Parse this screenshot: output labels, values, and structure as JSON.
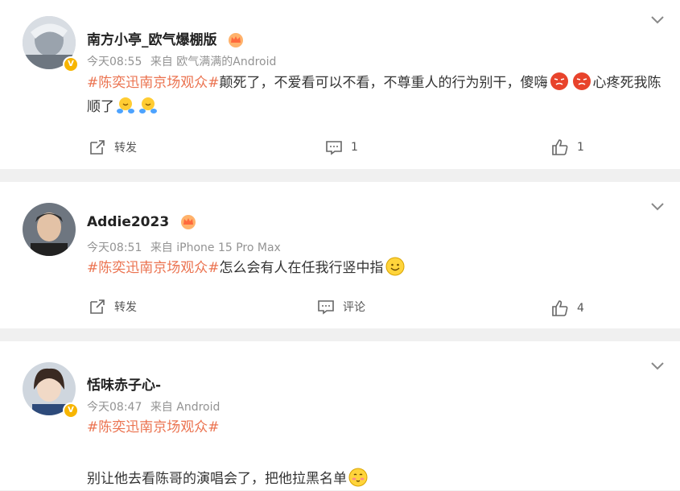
{
  "posts": [
    {
      "username": "南方小亭_欧气爆棚版",
      "time": "今天08:55",
      "source": "来自 欧气满满的Android",
      "hashtag": "#陈奕迅南京场观众#",
      "text_a": "颠死了，不爱看可以不看，不尊重人的行为别干，傻嗨",
      "text_b": "心疼死我陈顺了",
      "repost_label": "转发",
      "comment_label": "1",
      "like_count": "1"
    },
    {
      "username": "Addie2023",
      "time": "今天08:51",
      "source": "来自 iPhone 15 Pro Max",
      "hashtag": "#陈奕迅南京场观众#",
      "text_a": "怎么会有人在任我行竖中指",
      "repost_label": "转发",
      "comment_label": "评论",
      "like_count": "4"
    },
    {
      "username": "恬味赤子心-",
      "time": "今天08:47",
      "source": "来自 Android",
      "hashtag": "#陈奕迅南京场观众#",
      "text_a": "别让他去看陈哥的演唱会了，把他拉黑名单"
    }
  ],
  "colors": {
    "hashtag": "#eb7350",
    "meta": "#939393",
    "badge": "#f7b500"
  },
  "icons": [
    "chevron-down-icon",
    "repost-icon",
    "comment-icon",
    "like-icon",
    "crown-icon",
    "verified-badge-icon",
    "angry-emoji-icon",
    "hug-emoji-icon",
    "smile-emoji-icon",
    "shy-emoji-icon"
  ]
}
